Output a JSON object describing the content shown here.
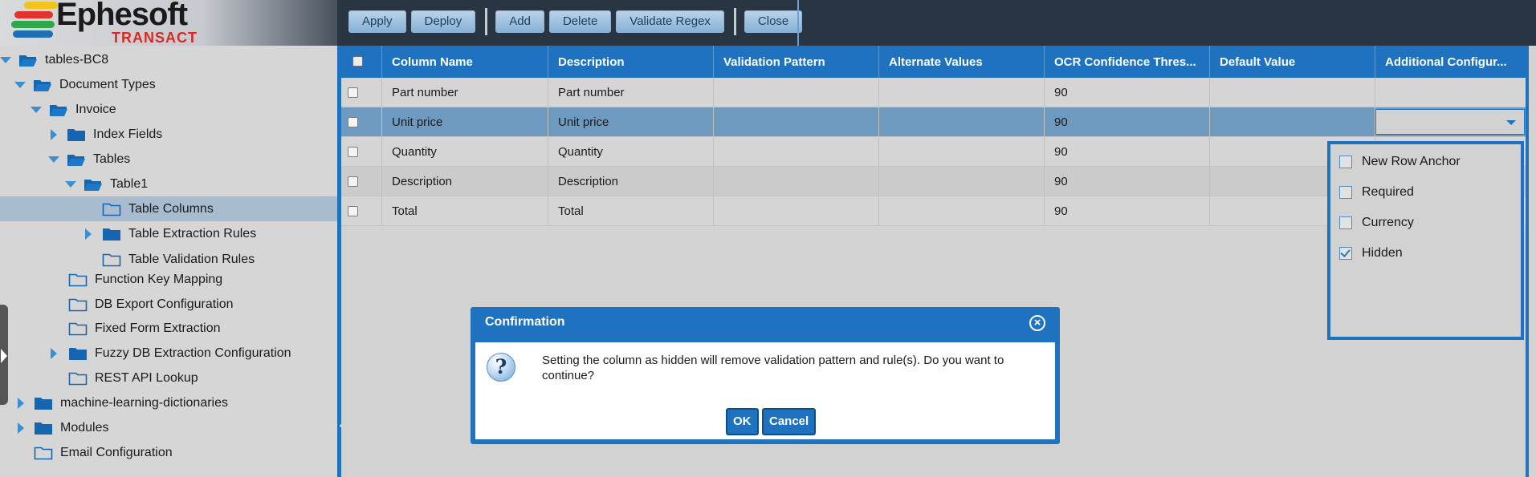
{
  "header": {
    "logo_text": "Ephesoft",
    "logo_sub": "TRANSACT",
    "toolbar": {
      "apply": "Apply",
      "deploy": "Deploy",
      "add": "Add",
      "delete": "Delete",
      "validate_regex": "Validate Regex",
      "close": "Close"
    }
  },
  "tree": {
    "items": [
      {
        "label": "tables-BC8"
      },
      {
        "label": "Document Types"
      },
      {
        "label": "Invoice"
      },
      {
        "label": "Index Fields"
      },
      {
        "label": "Tables"
      },
      {
        "label": "Table1"
      },
      {
        "label": "Table Columns"
      },
      {
        "label": "Table Extraction Rules"
      },
      {
        "label": "Table Validation Rules"
      },
      {
        "label": "Function Key Mapping"
      },
      {
        "label": "DB Export Configuration"
      },
      {
        "label": "Fixed Form Extraction"
      },
      {
        "label": "Fuzzy DB Extraction Configuration"
      },
      {
        "label": "REST API Lookup"
      },
      {
        "label": "machine-learning-dictionaries"
      },
      {
        "label": "Modules"
      },
      {
        "label": "Email Configuration"
      }
    ]
  },
  "grid": {
    "columns": [
      "Column Name",
      "Description",
      "Validation Pattern",
      "Alternate Values",
      "OCR Confidence Thres...",
      "Default Value",
      "Additional Configur..."
    ],
    "rows": [
      {
        "name": "Part number",
        "description": "Part number",
        "ocr": "90"
      },
      {
        "name": "Unit price",
        "description": "Unit price",
        "ocr": "90"
      },
      {
        "name": "Quantity",
        "description": "Quantity",
        "ocr": "90"
      },
      {
        "name": "Description",
        "description": "Description",
        "ocr": "90"
      },
      {
        "name": "Total",
        "description": "Total",
        "ocr": "90"
      }
    ]
  },
  "config_panel": {
    "options": [
      {
        "label": "New Row Anchor",
        "checked": false
      },
      {
        "label": "Required",
        "checked": false
      },
      {
        "label": "Currency",
        "checked": false
      },
      {
        "label": "Hidden",
        "checked": true
      }
    ]
  },
  "dialog": {
    "title": "Confirmation",
    "message": "Setting the column as hidden will remove validation pattern and rule(s). Do you want to continue?",
    "ok": "OK",
    "cancel": "Cancel"
  },
  "colors": {
    "accent": "#1e72c0",
    "header_bg": "#2a3544",
    "selected_row": "#6f9ac0"
  }
}
